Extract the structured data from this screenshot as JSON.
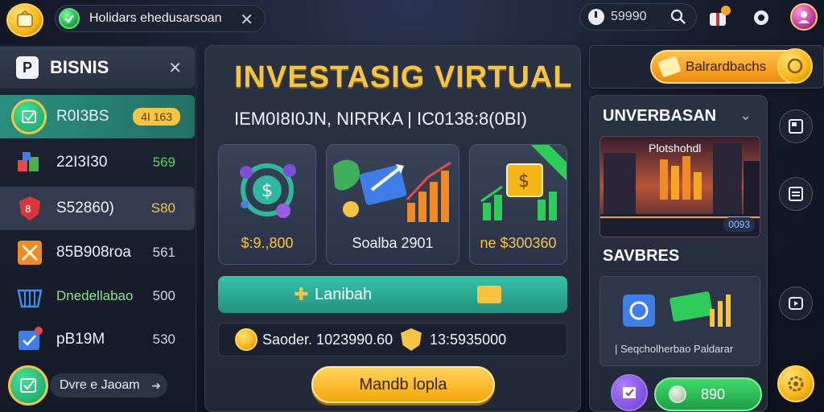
{
  "topbar": {
    "notice_text": "Holidars ehedusarsoan",
    "search_value": "59990"
  },
  "sidebar": {
    "title": "BISNIS",
    "items": [
      {
        "label": "R0I3BS",
        "value": "4I 163"
      },
      {
        "label": "22I3I30",
        "value": "569"
      },
      {
        "label": "S52860)",
        "value": "S80"
      },
      {
        "label": "85B908roa",
        "value": "561"
      },
      {
        "label": "Dnedellabao",
        "value": "500"
      },
      {
        "label": "pB19M",
        "value": "530"
      }
    ],
    "footer_label": "Dvre e Jaoam"
  },
  "main": {
    "title": "INVESTASIG VIRTUAL",
    "subtitle": "IEM0I8I0JN, NIRRKA | IC0138:8(0BI)",
    "cards": [
      {
        "label": "$:9.,800"
      },
      {
        "label": "Soalba 2901"
      },
      {
        "label": "ne $300360"
      }
    ],
    "action_label": "Lanibah",
    "stat_a": "Saoder. 1023990.60",
    "stat_b": "13:5935000",
    "cta_label": "Mandb lopla"
  },
  "right": {
    "balance_button": "Balrardbachs",
    "section_title": "UNVERBASAN",
    "image_caption": "Plotshohdl",
    "image_badge": "0093",
    "savings_title": "SAVBRES",
    "savings_caption": "| Seqcholherbao Paldarar",
    "coin_value": "890"
  },
  "colors": {
    "accent_gold": "#f5c542",
    "accent_teal": "#2fb8a0",
    "accent_green": "#2ecc5b",
    "bg": "#161b2c"
  }
}
